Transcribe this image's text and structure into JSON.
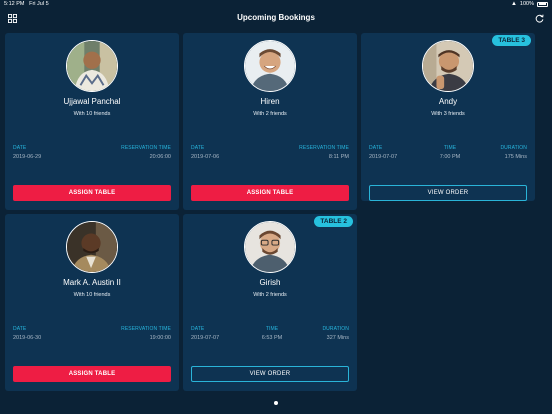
{
  "status_bar": {
    "time": "5:12 PM",
    "date": "Fri Jul 5",
    "battery": "100%"
  },
  "header": {
    "title": "Upcoming Bookings",
    "left_icon": "grid-icon",
    "right_icon": "refresh-icon"
  },
  "colors": {
    "background": "#0b2236",
    "card": "#0e3352",
    "accent": "#27b5dd",
    "assign": "#ee1d44",
    "badge": "#27c1de"
  },
  "bookings": [
    {
      "name": "Ujjawal Panchal",
      "friends": "With 10 friends",
      "col1_label": "DATE",
      "col1_value": "2019-06-29",
      "col2_label": "RESERVATION TIME",
      "col2_value": "20:06:00",
      "button": "ASSIGN TABLE"
    },
    {
      "name": "Hiren",
      "friends": "With 2 friends",
      "col1_label": "DATE",
      "col1_value": "2019-07-06",
      "col2_label": "RESERVATION TIME",
      "col2_value": "8:11 PM",
      "button": "ASSIGN TABLE"
    },
    {
      "name": "Andy",
      "friends": "With 3 friends",
      "badge": "TABLE 3",
      "col1_label": "DATE",
      "col1_value": "2019-07-07",
      "col2_label": "TIME",
      "col2_value": "7:00 PM",
      "col3_label": "DURATION",
      "col3_value": "175 Mins",
      "button": "VIEW ORDER"
    },
    {
      "name": "Mark A. Austin II",
      "friends": "With 10 friends",
      "col1_label": "DATE",
      "col1_value": "2019-06-30",
      "col2_label": "RESERVATION TIME",
      "col2_value": "19:00:00",
      "button": "ASSIGN TABLE"
    },
    {
      "name": "Girish",
      "friends": "With 2 friends",
      "badge": "TABLE 2",
      "col1_label": "DATE",
      "col1_value": "2019-07-07",
      "col2_label": "TIME",
      "col2_value": "6:53 PM",
      "col3_label": "DURATION",
      "col3_value": "327 Mins",
      "button": "VIEW ORDER"
    }
  ]
}
